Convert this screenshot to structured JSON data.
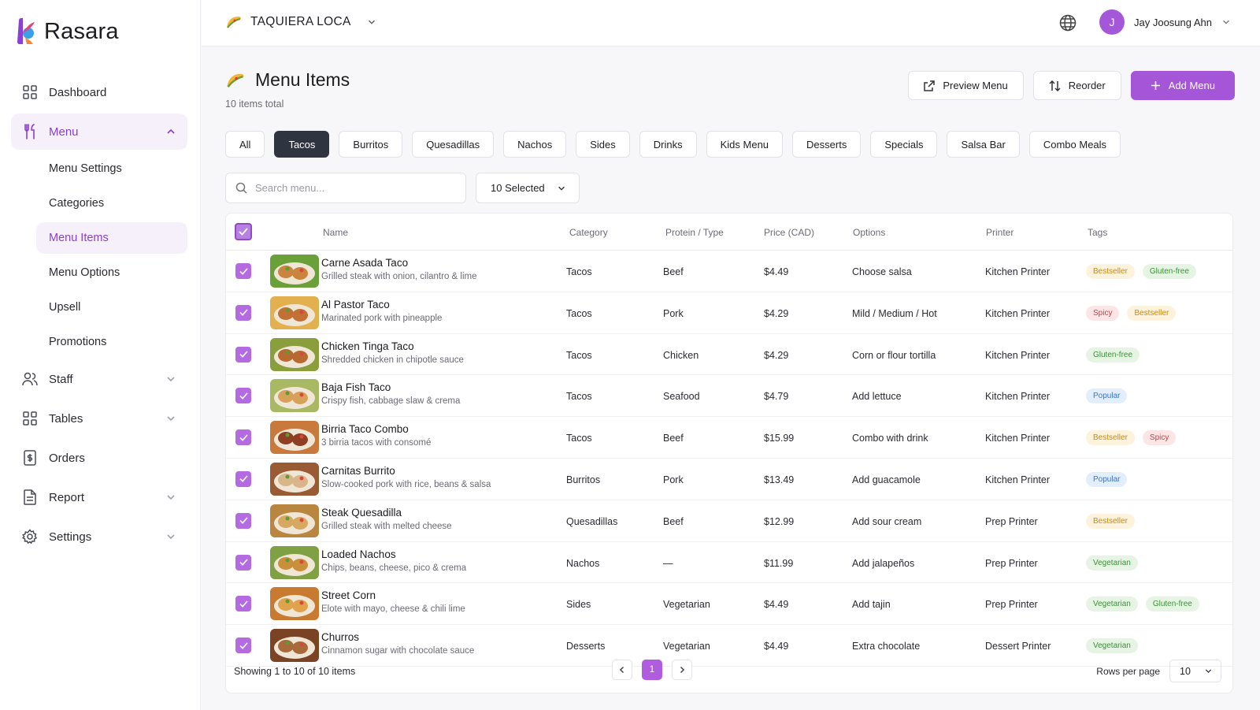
{
  "app": {
    "name": "Rasara"
  },
  "sidebar": {
    "items": [
      {
        "label": "Dashboard",
        "icon": "grid-icon"
      },
      {
        "label": "Menu",
        "icon": "utensils-icon"
      },
      {
        "label": "Staff",
        "icon": "users-icon"
      },
      {
        "label": "Tables",
        "icon": "grid-icon"
      },
      {
        "label": "Orders",
        "icon": "receipt-icon"
      },
      {
        "label": "Report",
        "icon": "document-icon"
      },
      {
        "label": "Settings",
        "icon": "gear-icon"
      }
    ],
    "menu_sub": [
      "Menu Settings",
      "Categories",
      "Menu Items",
      "Menu Options",
      "Upsell",
      "Promotions"
    ]
  },
  "topbar": {
    "restaurant": "TAQUIERA LOCA",
    "user_initial": "J",
    "user_name": "Jay Joosung Ahn"
  },
  "header": {
    "title": "Menu Items",
    "subtitle": "10 items total",
    "preview": "Preview Menu",
    "reorder": "Reorder",
    "add": "Add Menu"
  },
  "tabs": [
    "All",
    "Tacos",
    "Burritos",
    "Quesadillas",
    "Nachos",
    "Sides",
    "Drinks",
    "Kids Menu",
    "Desserts",
    "Specials",
    "Salsa Bar",
    "Combo Meals"
  ],
  "filters": {
    "search_placeholder": "Search menu...",
    "selected": "10 Selected"
  },
  "table": {
    "headers": [
      "Name",
      "Category",
      "Protein / Type",
      "Price (CAD)",
      "Options",
      "Printer",
      "Tags"
    ],
    "rows": [
      {
        "name": "Carne Asada Taco",
        "desc": "Grilled steak with onion, cilantro & lime",
        "category": "Tacos",
        "protein": "Beef",
        "price": "$4.49",
        "options": "Choose salsa",
        "printer": "Kitchen Printer",
        "tags": [
          "Bestseller",
          "Gluten-free"
        ]
      },
      {
        "name": "Al Pastor Taco",
        "desc": "Marinated pork with pineapple",
        "category": "Tacos",
        "protein": "Pork",
        "price": "$4.29",
        "options": "Mild / Medium / Hot",
        "printer": "Kitchen Printer",
        "tags": [
          "Spicy",
          "Bestseller"
        ]
      },
      {
        "name": "Chicken Tinga Taco",
        "desc": "Shredded chicken in chipotle sauce",
        "category": "Tacos",
        "protein": "Chicken",
        "price": "$4.29",
        "options": "Corn or flour tortilla",
        "printer": "Kitchen Printer",
        "tags": [
          "Gluten-free"
        ]
      },
      {
        "name": "Baja Fish Taco",
        "desc": "Crispy fish, cabbage slaw & crema",
        "category": "Tacos",
        "protein": "Seafood",
        "price": "$4.79",
        "options": "Add lettuce",
        "printer": "Kitchen Printer",
        "tags": [
          "Popular"
        ]
      },
      {
        "name": "Birria Taco Combo",
        "desc": "3 birria tacos with consomé",
        "category": "Tacos",
        "protein": "Beef",
        "price": "$15.99",
        "options": "Combo with drink",
        "printer": "Kitchen Printer",
        "tags": [
          "Bestseller",
          "Spicy"
        ]
      },
      {
        "name": "Carnitas Burrito",
        "desc": "Slow-cooked pork with rice, beans & salsa",
        "category": "Burritos",
        "protein": "Pork",
        "price": "$13.49",
        "options": "Add guacamole",
        "printer": "Kitchen Printer",
        "tags": [
          "Popular"
        ]
      },
      {
        "name": "Steak Quesadilla",
        "desc": "Grilled steak with melted cheese",
        "category": "Quesadillas",
        "protein": "Beef",
        "price": "$12.99",
        "options": "Add sour cream",
        "printer": "Prep Printer",
        "tags": [
          "Bestseller"
        ]
      },
      {
        "name": "Loaded Nachos",
        "desc": "Chips, beans, cheese, pico & crema",
        "category": "Nachos",
        "protein": "—",
        "price": "$11.99",
        "options": "Add jalapeños",
        "printer": "Prep Printer",
        "tags": [
          "Vegetarian"
        ]
      },
      {
        "name": "Street Corn",
        "desc": "Elote with mayo, cheese & chili lime",
        "category": "Sides",
        "protein": "Vegetarian",
        "price": "$4.49",
        "options": "Add tajin",
        "printer": "Prep Printer",
        "tags": [
          "Vegetarian",
          "Gluten-free"
        ]
      },
      {
        "name": "Churros",
        "desc": "Cinnamon sugar with chocolate sauce",
        "category": "Desserts",
        "protein": "Vegetarian",
        "price": "$4.49",
        "options": "Extra chocolate",
        "printer": "Dessert Printer",
        "tags": [
          "Vegetarian"
        ]
      }
    ]
  },
  "footer": {
    "showing": "Showing 1 to 10 of 10 items",
    "page": "1",
    "rows_label": "Rows per page",
    "rows_value": "10"
  },
  "colors": {
    "accent": "#a455d8",
    "active_tab": "#2f3441"
  }
}
